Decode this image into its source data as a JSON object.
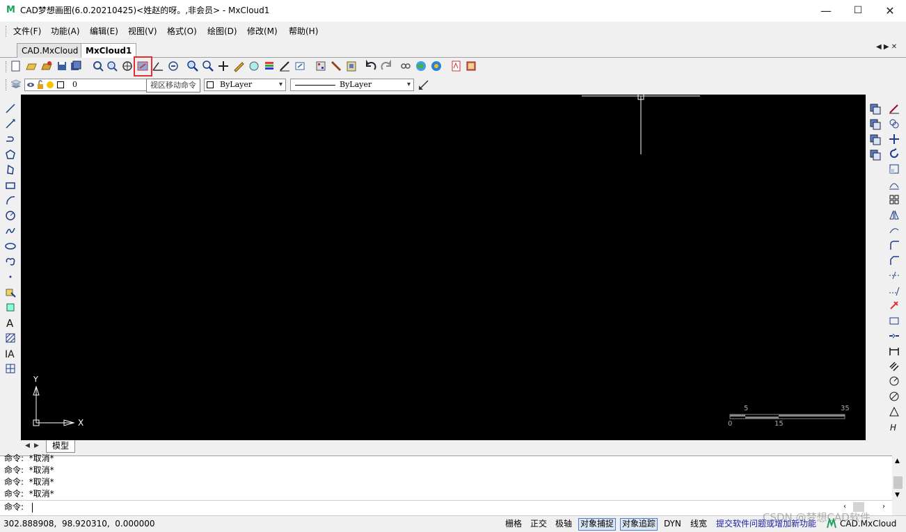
{
  "window": {
    "title": "CAD梦想画图(6.0.20210425)<姓赵的呀。,非会员> - MxCloud1",
    "app_icon": "M",
    "minimize": "—",
    "maximize": "☐",
    "close": "✕"
  },
  "menu": {
    "items": [
      "文件(F)",
      "功能(A)",
      "编辑(E)",
      "视图(V)",
      "格式(O)",
      "绘图(D)",
      "修改(M)",
      "帮助(H)"
    ]
  },
  "tabs": {
    "items": [
      "CAD.MxCloud",
      "MxCloud1"
    ],
    "active": "MxCloud1",
    "nav": "◀ ▶ ✕"
  },
  "toolbar": {
    "tooltip": "视区移动命令",
    "highlighted_icon": "pan-view-icon",
    "layer_value": "0",
    "color_value": "ByLayer",
    "linetype_value": "ByLayer"
  },
  "canvas": {
    "ucs_y": "Y",
    "ucs_x": "X",
    "scale_top_labels": [
      "5",
      "35"
    ],
    "scale_bottom_labels": [
      "0",
      "15"
    ]
  },
  "model_tabs": {
    "nav_left": "◀",
    "nav_right": "▶",
    "model_label": "模型"
  },
  "command": {
    "history": [
      "命令:  *取消*",
      "命令:  *取消*",
      "命令:  *取消*",
      "命令:  *取消*"
    ],
    "prompt": "命令:"
  },
  "status": {
    "coordinates": "302.888908,  98.920310,  0.000000",
    "toggles": [
      {
        "label": "栅格",
        "on": false
      },
      {
        "label": "正交",
        "on": false
      },
      {
        "label": "极轴",
        "on": false
      },
      {
        "label": "对象捕捉",
        "on": true
      },
      {
        "label": "对象追踪",
        "on": true
      },
      {
        "label": "DYN",
        "on": false
      },
      {
        "label": "线宽",
        "on": false
      }
    ],
    "feedback_link": "提交软件问题或增加新功能",
    "brand": "CAD.MxCloud",
    "watermark": "CSDN @梦想CAD软件"
  },
  "colors": {
    "canvas": "#000000",
    "highlight": "#e03030",
    "link": "#1a1aa6",
    "toggle_on": "#dbe8f8"
  }
}
